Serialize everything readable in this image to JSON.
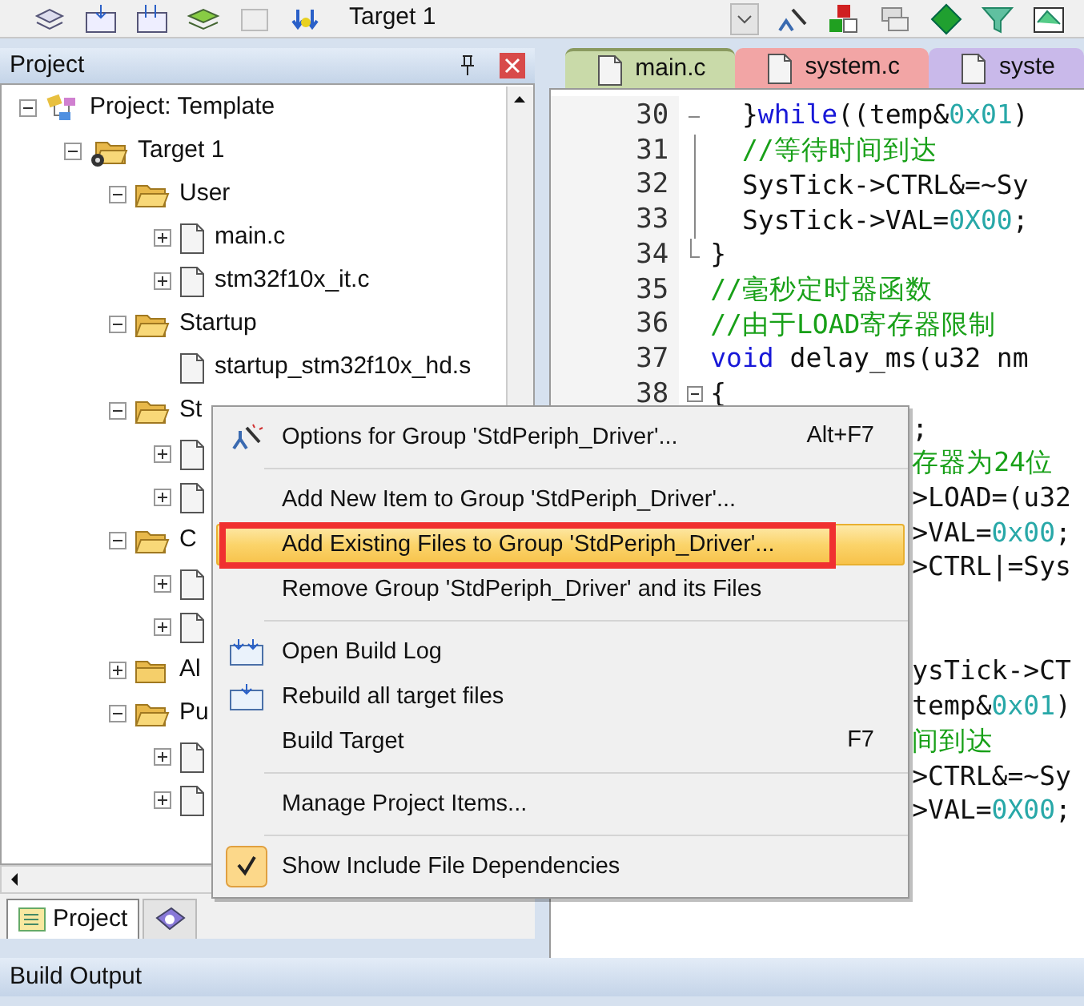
{
  "toolbar": {
    "target": "Target 1"
  },
  "project_panel": {
    "title": "Project",
    "tree": [
      {
        "label": "Project: Template",
        "kind": "project",
        "expanded": true,
        "children": [
          {
            "label": "Target 1",
            "kind": "target",
            "expanded": true,
            "children": [
              {
                "label": "User",
                "kind": "group",
                "expanded": true,
                "children": [
                  {
                    "label": "main.c",
                    "kind": "file",
                    "expandable": true
                  },
                  {
                    "label": "stm32f10x_it.c",
                    "kind": "file",
                    "expandable": true
                  }
                ]
              },
              {
                "label": "Startup",
                "kind": "group",
                "expanded": true,
                "children": [
                  {
                    "label": "startup_stm32f10x_hd.s",
                    "kind": "file",
                    "expandable": false
                  }
                ]
              },
              {
                "label": "St",
                "kind": "group",
                "expanded": true,
                "children": [
                  {
                    "kind": "file",
                    "expandable": true
                  },
                  {
                    "kind": "file",
                    "expandable": true
                  }
                ]
              },
              {
                "label": "C",
                "kind": "group",
                "expanded": true,
                "children": [
                  {
                    "kind": "file",
                    "expandable": true
                  },
                  {
                    "kind": "file",
                    "expandable": true
                  }
                ]
              },
              {
                "label": "Al",
                "kind": "group",
                "expanded": false
              },
              {
                "label": "Pu",
                "kind": "group",
                "expanded": true,
                "children": [
                  {
                    "kind": "file",
                    "expandable": true
                  },
                  {
                    "kind": "file",
                    "expandable": true
                  }
                ]
              }
            ]
          }
        ]
      }
    ]
  },
  "bottom_tabs": [
    {
      "label": "Project",
      "kind": "project",
      "selected": true
    },
    {
      "kind": "books",
      "selected": false
    }
  ],
  "editor": {
    "tabs": [
      {
        "label": "main.c",
        "color": "#c9daa9",
        "selected": true
      },
      {
        "label": "system.c",
        "color": "#f2a5a5",
        "selected": false
      },
      {
        "label": "syste",
        "color": "#c9b9ea",
        "selected": false
      }
    ],
    "lines": [
      {
        "number": "30",
        "kind": "fold_start",
        "segments": [
          {
            "text": "  }",
            "kind": "code"
          },
          {
            "text": "while",
            "kind": "keyword"
          },
          {
            "text": "((temp&",
            "kind": "code"
          },
          {
            "text": "0x01",
            "kind": "number"
          },
          {
            "text": ")",
            "kind": "code"
          }
        ]
      },
      {
        "number": "31",
        "kind": "fold_inner",
        "segments": [
          {
            "text": "  //等待时间到达",
            "kind": "comment"
          }
        ]
      },
      {
        "number": "32",
        "kind": "fold_inner",
        "segments": [
          {
            "text": "  SysTick->CTRL&=~Sy",
            "kind": "code"
          }
        ]
      },
      {
        "number": "33",
        "kind": "fold_inner",
        "segments": [
          {
            "text": "  SysTick->VAL=",
            "kind": "code"
          },
          {
            "text": "0X00",
            "kind": "number"
          },
          {
            "text": ";",
            "kind": "code"
          }
        ]
      },
      {
        "number": "34",
        "kind": "fold_end",
        "segments": [
          {
            "text": "}",
            "kind": "code"
          }
        ]
      },
      {
        "number": "35",
        "kind": "plain",
        "segments": [
          {
            "text": "//毫秒定时器函数",
            "kind": "comment"
          }
        ]
      },
      {
        "number": "36",
        "kind": "plain",
        "segments": [
          {
            "text": "//由于LOAD寄存器限制",
            "kind": "comment"
          }
        ]
      },
      {
        "number": "37",
        "kind": "plain",
        "segments": [
          {
            "text": "void",
            "kind": "keyword"
          },
          {
            "text": " delay_ms(u32 nm",
            "kind": "code"
          }
        ]
      },
      {
        "number": "38",
        "kind": "fold_box",
        "segments": [
          {
            "text": "{",
            "kind": "code"
          }
        ]
      },
      {
        "kind": "clipped",
        "segments": [
          {
            "text": ";",
            "kind": "code"
          }
        ]
      },
      {
        "kind": "clipped",
        "segments": [
          {
            "text": "存器为24位",
            "kind": "comment"
          }
        ]
      },
      {
        "kind": "clipped",
        "segments": [
          {
            "text": ">LOAD=(u32",
            "kind": "code"
          }
        ]
      },
      {
        "kind": "clipped",
        "segments": [
          {
            "text": ">VAL=",
            "kind": "code"
          },
          {
            "text": "0x00",
            "kind": "number"
          },
          {
            "text": ";",
            "kind": "code"
          }
        ]
      },
      {
        "kind": "clipped",
        "segments": [
          {
            "text": ">CTRL|=Sys",
            "kind": "code"
          }
        ]
      },
      {
        "kind": "blank"
      },
      {
        "kind": "blank"
      },
      {
        "kind": "clipped",
        "segments": [
          {
            "text": "ysTick->CT",
            "kind": "code"
          }
        ]
      },
      {
        "kind": "clipped",
        "segments": [
          {
            "text": "temp&",
            "kind": "code"
          },
          {
            "text": "0x01",
            "kind": "number"
          },
          {
            "text": ")",
            "kind": "code"
          }
        ]
      },
      {
        "kind": "clipped",
        "segments": [
          {
            "text": "间到达",
            "kind": "comment"
          }
        ]
      },
      {
        "kind": "clipped",
        "segments": [
          {
            "text": ">CTRL&=~Sy",
            "kind": "code"
          }
        ]
      },
      {
        "kind": "clipped",
        "segments": [
          {
            "text": ">VAL=",
            "kind": "code"
          },
          {
            "text": "0X00",
            "kind": "number"
          },
          {
            "text": ";",
            "kind": "code"
          }
        ]
      }
    ]
  },
  "context_menu": {
    "items": [
      {
        "kind": "item",
        "label": "Options for Group 'StdPeriph_Driver'...",
        "shortcut": "Alt+F7",
        "highlighted": false,
        "checked": false
      },
      {
        "kind": "separator"
      },
      {
        "kind": "item",
        "label": "Add New  Item to Group 'StdPeriph_Driver'...",
        "highlighted": false,
        "checked": false
      },
      {
        "kind": "item",
        "label": "Add Existing Files to Group 'StdPeriph_Driver'...",
        "highlighted": true,
        "checked": false
      },
      {
        "kind": "item",
        "label": "Remove Group 'StdPeriph_Driver' and its Files",
        "highlighted": false,
        "checked": false
      },
      {
        "kind": "separator"
      },
      {
        "kind": "item",
        "label": "Open Build Log",
        "highlighted": false,
        "checked": false
      },
      {
        "kind": "item",
        "label": "Rebuild all target files",
        "highlighted": false,
        "checked": false
      },
      {
        "kind": "item",
        "label": "Build Target",
        "shortcut": "F7",
        "highlighted": false,
        "checked": false
      },
      {
        "kind": "separator"
      },
      {
        "kind": "item",
        "label": "Manage Project Items...",
        "highlighted": false,
        "checked": false
      },
      {
        "kind": "separator"
      },
      {
        "kind": "item",
        "label": "Show Include File Dependencies",
        "highlighted": false,
        "checked": true
      }
    ]
  },
  "build_output": {
    "title": "Build Output"
  }
}
